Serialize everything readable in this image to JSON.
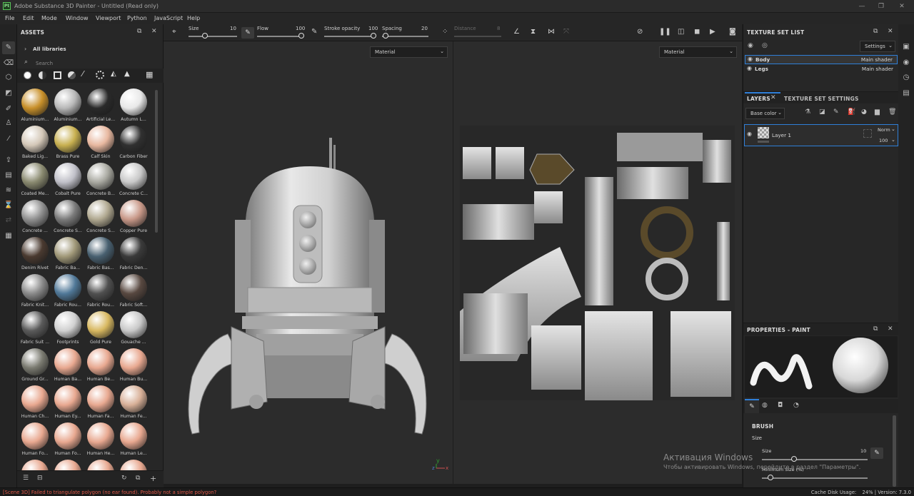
{
  "window": {
    "app_icon": "Pt",
    "title": "Adobe Substance 3D Painter - Untitled (Read only)",
    "minimize": "—",
    "maximize": "❐",
    "close": "✕"
  },
  "menu": [
    "File",
    "Edit",
    "Mode",
    "Window",
    "Viewport",
    "Python",
    "JavaScript",
    "Help"
  ],
  "assets": {
    "title": "ASSETS",
    "library": "All libraries",
    "search_placeholder": "Search",
    "materials": [
      {
        "label": "Aluminium...",
        "color": "#c8902a"
      },
      {
        "label": "Aluminium...",
        "color": "#b8b8b8"
      },
      {
        "label": "Artificial Le...",
        "color": "#2a2a2a"
      },
      {
        "label": "Autumn L...",
        "color": "#e8e8e8"
      },
      {
        "label": "Baked Lig...",
        "color": "#d4c8b8"
      },
      {
        "label": "Brass Pure",
        "color": "#c8b050"
      },
      {
        "label": "Calf Skin",
        "color": "#e8b8a0"
      },
      {
        "label": "Carbon Fiber",
        "color": "#303030"
      },
      {
        "label": "Coated Me...",
        "color": "#8a8a70"
      },
      {
        "label": "Cobalt Pure",
        "color": "#c0c0c8"
      },
      {
        "label": "Concrete B...",
        "color": "#a8a8a0"
      },
      {
        "label": "Concrete C...",
        "color": "#c8c8c8"
      },
      {
        "label": "Concrete ...",
        "color": "#909090"
      },
      {
        "label": "Concrete S...",
        "color": "#7a7a7a"
      },
      {
        "label": "Concrete S...",
        "color": "#b0a890"
      },
      {
        "label": "Copper Pure",
        "color": "#c89888"
      },
      {
        "label": "Denim Rivet",
        "color": "#4a3a30"
      },
      {
        "label": "Fabric Ba...",
        "color": "#a09878"
      },
      {
        "label": "Fabric Bas...",
        "color": "#486070"
      },
      {
        "label": "Fabric Den...",
        "color": "#3a3a3a"
      },
      {
        "label": "Fabric Knit...",
        "color": "#8a8a8a"
      },
      {
        "label": "Fabric Rou...",
        "color": "#507898"
      },
      {
        "label": "Fabric Rou...",
        "color": "#505050"
      },
      {
        "label": "Fabric Soft...",
        "color": "#584840"
      },
      {
        "label": "Fabric Suit ...",
        "color": "#5a5a5a"
      },
      {
        "label": "Footprints",
        "color": "#d0d0d0"
      },
      {
        "label": "Gold Pure",
        "color": "#d8b860"
      },
      {
        "label": "Gouache ...",
        "color": "#c8c8c8"
      },
      {
        "label": "Ground Gr...",
        "color": "#7a7a70"
      },
      {
        "label": "Human Ba...",
        "color": "#e8a890"
      },
      {
        "label": "Human Be...",
        "color": "#e8a890"
      },
      {
        "label": "Human Bu...",
        "color": "#e8a890"
      },
      {
        "label": "Human Ch...",
        "color": "#e8a890"
      },
      {
        "label": "Human Ey...",
        "color": "#e8a890"
      },
      {
        "label": "Human Fa...",
        "color": "#e8a890"
      },
      {
        "label": "Human Fe...",
        "color": "#d8b098"
      },
      {
        "label": "Human Fo...",
        "color": "#e8a890"
      },
      {
        "label": "Human Fo...",
        "color": "#e8a890"
      },
      {
        "label": "Human He...",
        "color": "#e8a890"
      },
      {
        "label": "Human Le...",
        "color": "#e8a890"
      },
      {
        "label": "",
        "color": "#e8a890"
      },
      {
        "label": "",
        "color": "#e8a890"
      },
      {
        "label": "",
        "color": "#e8a890"
      },
      {
        "label": "",
        "color": "#e8a890"
      }
    ]
  },
  "toolbar": {
    "size_label": "Size",
    "size_value": "10",
    "flow_label": "Flow",
    "flow_value": "100",
    "opacity_label": "Stroke opacity",
    "opacity_value": "100",
    "spacing_label": "Spacing",
    "spacing_value": "20",
    "distance_label": "Distance",
    "distance_value": "8"
  },
  "viewport3d": {
    "select": "Material"
  },
  "viewport2d": {
    "select": "Material"
  },
  "texture_set_list": {
    "title": "TEXTURE SET LIST",
    "settings": "Settings",
    "rows": [
      {
        "name": "Body",
        "shader": "Main shader"
      },
      {
        "name": "Legs",
        "shader": "Main shader"
      }
    ]
  },
  "layers": {
    "tab_layers": "LAYERS",
    "tab_settings": "TEXTURE SET SETTINGS",
    "channel": "Base color",
    "layer_name": "Layer 1",
    "blend": "Norm",
    "opacity": "100"
  },
  "properties": {
    "title": "PROPERTIES - PAINT",
    "section": "BRUSH",
    "size_label": "Size",
    "size_sub_label": "Size",
    "size_value": "10",
    "min_size_label": "Minimum Size (%)"
  },
  "watermark": {
    "title": "Активация Windows",
    "subtitle": "Чтобы активировать Windows, перейдите в раздел \"Параметры\"."
  },
  "status": {
    "error": "[Scene 3D] Failed to triangulate polygon (no ear found). Probably not a simple polygon?",
    "cache_label": "Cache Disk Usage:",
    "cache_value": "24%",
    "version": "Version: 7.3.0"
  },
  "colors": {
    "accent": "#2f7fd8",
    "error": "#e25a4a"
  }
}
